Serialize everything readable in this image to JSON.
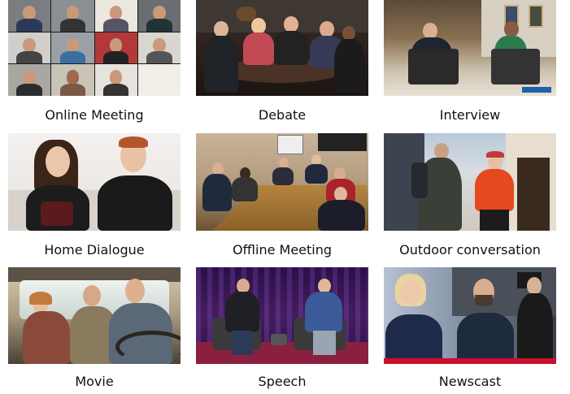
{
  "tiles": [
    {
      "caption": "Online Meeting"
    },
    {
      "caption": "Debate"
    },
    {
      "caption": "Interview"
    },
    {
      "caption": "Home Dialogue"
    },
    {
      "caption": "Offline Meeting"
    },
    {
      "caption": "Outdoor conversation"
    },
    {
      "caption": "Movie"
    },
    {
      "caption": "Speech"
    },
    {
      "caption": "Newscast"
    }
  ],
  "colors": {
    "caption_text": "#111111",
    "newscast_red": "#c8102e",
    "speech_purple": "#3a1a5a"
  }
}
